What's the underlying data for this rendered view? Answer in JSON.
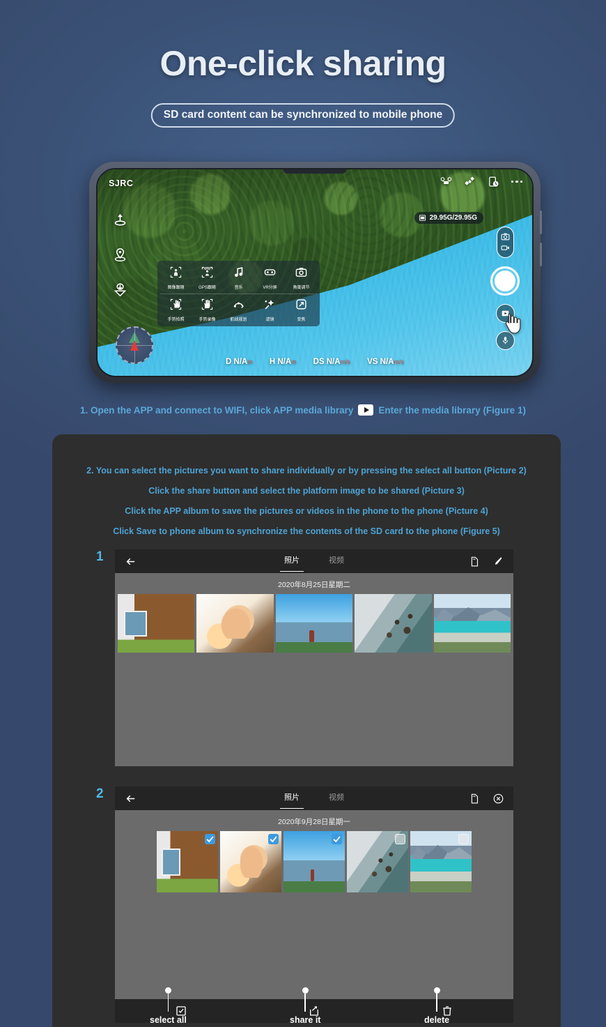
{
  "header": {
    "title": "One-click sharing",
    "subtitle": "SD card content can be synchronized to mobile phone"
  },
  "phone": {
    "brand_logo": "SJRC",
    "storage": "29.95G/29.95G",
    "topbar_icons": [
      "drone-icon",
      "satellite-icon",
      "battery-time-icon",
      "more-dots-icon"
    ],
    "left_rail_icons": [
      "takeoff-icon",
      "location-pin-icon",
      "landing-icon"
    ],
    "right_rail": {
      "mode_toggle": [
        "photo-mode-icon",
        "video-mode-icon"
      ],
      "shutter": "shutter-button",
      "media_library": "media-library-play-icon",
      "mic": "microphone-icon"
    },
    "menu_items": [
      {
        "label": "图像跟随",
        "icon": "image-follow-icon"
      },
      {
        "label": "GPS跟随",
        "icon": "gps-follow-icon"
      },
      {
        "label": "音乐",
        "icon": "music-icon"
      },
      {
        "label": "VR分屏",
        "icon": "vr-split-icon"
      },
      {
        "label": "角度调节",
        "icon": "angle-adjust-icon"
      },
      {
        "label": "手势拍照",
        "icon": "gesture-photo-icon"
      },
      {
        "label": "手势录像",
        "icon": "gesture-video-icon"
      },
      {
        "label": "航线规划",
        "icon": "route-plan-icon"
      },
      {
        "label": "滤镜",
        "icon": "filter-icon"
      },
      {
        "label": "变焦",
        "icon": "zoom-icon"
      }
    ],
    "telemetry": [
      {
        "label": "D N/A",
        "unit": "m"
      },
      {
        "label": "H N/A",
        "unit": "m"
      },
      {
        "label": "DS N/A",
        "unit": "m/s"
      },
      {
        "label": "VS N/A",
        "unit": "m/s"
      }
    ]
  },
  "step1": {
    "before_icon": "1. Open the APP and connect to WIFI, click APP media library",
    "icon": "play-button-icon",
    "after_icon": "Enter the media library (Figure 1)"
  },
  "steps": [
    "2. You can select the pictures you want to share individually or by pressing the select all button (Picture 2)",
    "Click the share button and select the platform image to be shared (Picture 3)",
    "Click the APP album to save the pictures or videos in the phone to the phone (Picture 4)",
    "Click Save to phone album to synchronize the contents of the SD card to the phone (Figure 5)"
  ],
  "gallery1": {
    "badge": "1",
    "back_icon": "back-arrow-icon",
    "tabs": [
      {
        "label": "照片",
        "active": true
      },
      {
        "label": "视频",
        "active": false
      }
    ],
    "right_icons": [
      "sd-card-icon",
      "edit-pencil-icon"
    ],
    "date": "2020年8月25日星期二",
    "thumbnails": [
      {
        "name": "wooden-house-photo",
        "selected": false
      },
      {
        "name": "hand-sunlight-photo",
        "selected": false
      },
      {
        "name": "hiker-mountain-photo",
        "selected": false
      },
      {
        "name": "rocky-shore-photo",
        "selected": false
      },
      {
        "name": "turquoise-lake-photo",
        "selected": false
      }
    ]
  },
  "gallery2": {
    "badge": "2",
    "back_icon": "back-arrow-icon",
    "tabs": [
      {
        "label": "照片",
        "active": true
      },
      {
        "label": "视频",
        "active": false
      }
    ],
    "right_icons": [
      "sd-card-icon",
      "close-circle-icon"
    ],
    "date": "2020年9月28日星期一",
    "thumbnails": [
      {
        "name": "wooden-house-photo",
        "selected": true
      },
      {
        "name": "hand-sunlight-photo",
        "selected": true
      },
      {
        "name": "hiker-mountain-photo",
        "selected": true
      },
      {
        "name": "rocky-shore-photo",
        "selected": false
      },
      {
        "name": "turquoise-lake-photo",
        "selected": false
      }
    ],
    "bottom_actions": [
      {
        "icon": "select-all-checkbox-icon",
        "callout": "select all"
      },
      {
        "icon": "share-icon",
        "callout": "share it"
      },
      {
        "icon": "trash-icon",
        "callout": "delete"
      }
    ]
  },
  "colors": {
    "background": "#3a5175",
    "panel": "#2e2e2e",
    "accent_blue": "#4ea3d4",
    "badge_blue": "#4db8e8",
    "check_blue": "#3d9ae0"
  }
}
